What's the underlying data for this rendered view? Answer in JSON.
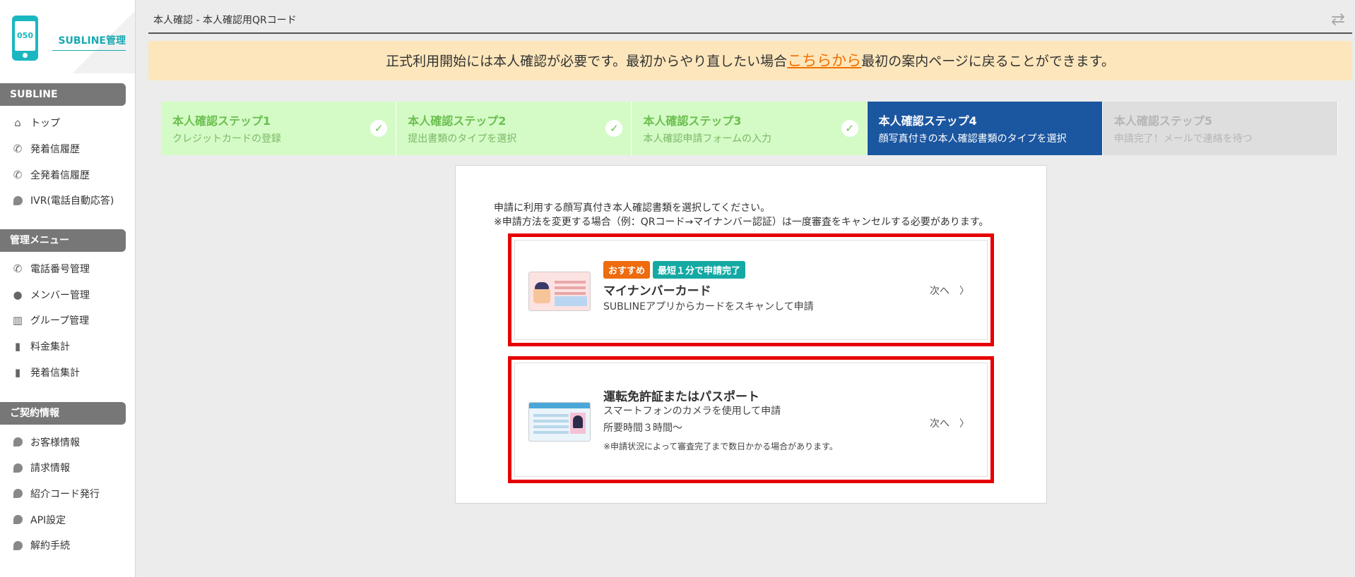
{
  "sidebar": {
    "logo_phone_text": "050",
    "app_title": "SUBLINE管理",
    "sections": [
      {
        "header": "SUBLINE",
        "items": [
          {
            "label": "トップ",
            "icon": "home-icon"
          },
          {
            "label": "発着信履歴",
            "icon": "phone-calls-icon"
          },
          {
            "label": "全発着信履歴",
            "icon": "phone-calls-icon"
          },
          {
            "label": "IVR(電話自動応答)",
            "icon": "bubble-icon"
          }
        ]
      },
      {
        "header": "管理メニュー",
        "items": [
          {
            "label": "電話番号管理",
            "icon": "phone-icon"
          },
          {
            "label": "メンバー管理",
            "icon": "user-icon"
          },
          {
            "label": "グループ管理",
            "icon": "building-icon"
          },
          {
            "label": "料金集計",
            "icon": "bar-chart-icon"
          },
          {
            "label": "発着信集計",
            "icon": "bar-chart-icon"
          }
        ]
      },
      {
        "header": "ご契約情報",
        "items": [
          {
            "label": "お客様情報",
            "icon": "bubble-icon"
          },
          {
            "label": "請求情報",
            "icon": "bubble-icon"
          },
          {
            "label": "紹介コード発行",
            "icon": "bubble-icon"
          },
          {
            "label": "API設定",
            "icon": "bubble-icon"
          },
          {
            "label": "解約手続",
            "icon": "bubble-icon"
          }
        ]
      }
    ]
  },
  "header": {
    "breadcrumb": "本人確認 - 本人確認用QRコード"
  },
  "notice": {
    "before": "正式利用開始には本人確認が必要です。最初からやり直したい場合",
    "link": "こちらから",
    "after": "最初の案内ページに戻ることができます。"
  },
  "steps": [
    {
      "title": "本人確認ステップ1",
      "desc": "クレジットカードの登録",
      "state": "done"
    },
    {
      "title": "本人確認ステップ2",
      "desc": "提出書類のタイプを選択",
      "state": "done"
    },
    {
      "title": "本人確認ステップ3",
      "desc": "本人確認申請フォームの入力",
      "state": "done"
    },
    {
      "title": "本人確認ステップ4",
      "desc": "顔写真付きの本人確認書類のタイプを選択",
      "state": "active"
    },
    {
      "title": "本人確認ステップ5",
      "desc": "申請完了！メールで連絡を待つ",
      "state": "todo"
    }
  ],
  "check_mark": "✓",
  "panel": {
    "line1": "申請に利用する顔写真付き本人確認書類を選択してください。",
    "line2": "※申請方法を変更する場合（例：QRコード→マイナンバー認証）は一度審査をキャンセルする必要があります。",
    "cards": [
      {
        "badges": [
          "おすすめ",
          "最短１分で申請完了"
        ],
        "title": "マイナンバーカード",
        "desc": "SUBLINEアプリからカードをスキャンして申請",
        "next": "次へ　〉"
      },
      {
        "title": "運転免許証またはパスポート",
        "desc": "スマートフォンのカメラを使用して申請",
        "time": "所要時間３時間〜",
        "note": "※申請状況によって審査完了まで数日かかる場合があります。",
        "next": "次へ　〉"
      }
    ]
  },
  "colors": {
    "accent": "#1bb7c1",
    "active_step": "#1b56a0",
    "done_step": "#d4fbc6",
    "highlight": "#e60000",
    "notice_bg": "#fde6bb"
  }
}
